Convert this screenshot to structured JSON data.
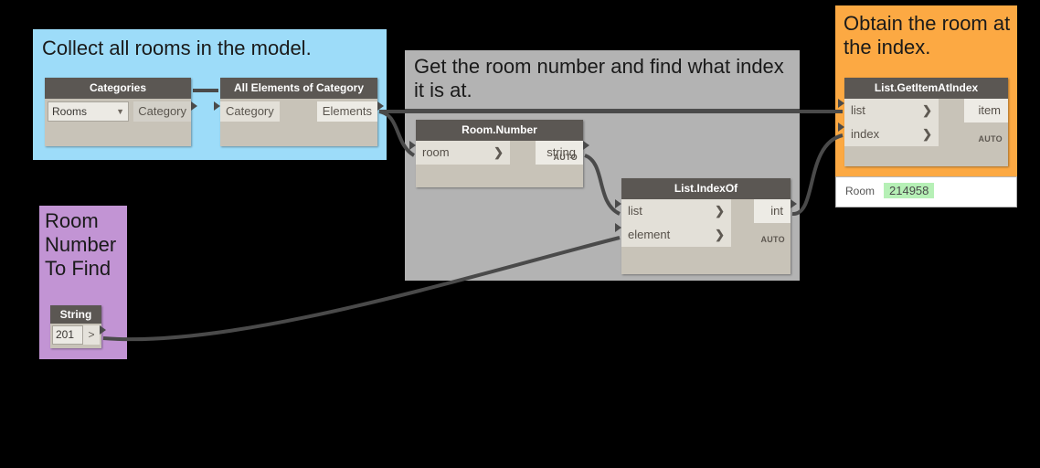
{
  "canvas": {
    "background": "#000000",
    "wire_color": "#4a4a4a"
  },
  "groups": [
    {
      "id": "collect",
      "title": "Collect all rooms in the model.",
      "color": "#9ddcf9"
    },
    {
      "id": "get",
      "title": "Get the room number and find what index it is at.",
      "color": "#b3b3b3"
    },
    {
      "id": "obtain",
      "title": "Obtain the room at the index.",
      "color": "#fca943"
    },
    {
      "id": "roomnum",
      "title": "Room Number To Find",
      "color": "#c294d4"
    }
  ],
  "nodes": {
    "categories": {
      "title": "Categories",
      "dropdown_value": "Rooms",
      "caret_icon": "chevron-down-icon",
      "output_label": "Category"
    },
    "all_elements_of_category": {
      "title": "All Elements of Category",
      "input_label": "Category",
      "output_label": "Elements"
    },
    "room_number": {
      "title": "Room.Number",
      "input_label": "room",
      "output_label": "string",
      "chevron_icon": "chevron-right-icon",
      "lacing": "AUTO"
    },
    "list_index_of": {
      "title": "List.IndexOf",
      "input_labels": [
        "list",
        "element"
      ],
      "output_label": "int",
      "chevron_icon": "chevron-right-icon",
      "lacing": "AUTO"
    },
    "list_get_item_at_index": {
      "title": "List.GetItemAtIndex",
      "input_labels": [
        "list",
        "index"
      ],
      "output_label": "item",
      "chevron_icon": "chevron-right-icon",
      "lacing": "AUTO"
    },
    "string": {
      "title": "String",
      "value": "201",
      "output_glyph": ">"
    },
    "watch": {
      "label": "Room",
      "value": "214958",
      "highlight_color": "#b6f0b6"
    }
  }
}
